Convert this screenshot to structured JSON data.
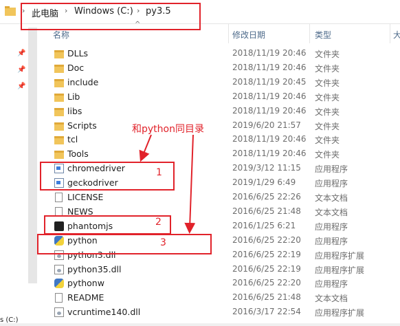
{
  "address": {
    "crumbs": [
      "此电脑",
      "Windows (C:)",
      "py3.5"
    ],
    "separator": "›",
    "up_chevron": "^"
  },
  "nav": {
    "bottom_label": "s (C:)"
  },
  "columns": {
    "name": "名称",
    "date": "修改日期",
    "type": "类型",
    "size": "大"
  },
  "files": [
    {
      "name": "DLLs",
      "date": "2018/11/19 20:46",
      "type": "文件夹",
      "icon": "folder-icon"
    },
    {
      "name": "Doc",
      "date": "2018/11/19 20:46",
      "type": "文件夹",
      "icon": "folder-icon"
    },
    {
      "name": "include",
      "date": "2018/11/19 20:45",
      "type": "文件夹",
      "icon": "folder-icon"
    },
    {
      "name": "Lib",
      "date": "2018/11/19 20:46",
      "type": "文件夹",
      "icon": "folder-icon"
    },
    {
      "name": "libs",
      "date": "2018/11/19 20:46",
      "type": "文件夹",
      "icon": "folder-icon"
    },
    {
      "name": "Scripts",
      "date": "2019/6/20 21:57",
      "type": "文件夹",
      "icon": "folder-icon"
    },
    {
      "name": "tcl",
      "date": "2018/11/19 20:46",
      "type": "文件夹",
      "icon": "folder-icon"
    },
    {
      "name": "Tools",
      "date": "2018/11/19 20:46",
      "type": "文件夹",
      "icon": "folder-icon"
    },
    {
      "name": "chromedriver",
      "date": "2019/3/12 11:15",
      "type": "应用程序",
      "icon": "exe-icon"
    },
    {
      "name": "geckodriver",
      "date": "2019/1/29 6:49",
      "type": "应用程序",
      "icon": "exe-icon"
    },
    {
      "name": "LICENSE",
      "date": "2016/6/25 22:26",
      "type": "文本文档",
      "icon": "text-file-icon"
    },
    {
      "name": "NEWS",
      "date": "2016/6/25 21:48",
      "type": "文本文档",
      "icon": "text-file-icon"
    },
    {
      "name": "phantomjs",
      "date": "2016/1/25 6:21",
      "type": "应用程序",
      "icon": "phantomjs-ghost-icon"
    },
    {
      "name": "python",
      "date": "2016/6/25 22:20",
      "type": "应用程序",
      "icon": "python-icon"
    },
    {
      "name": "python3.dll",
      "date": "2016/6/25 22:19",
      "type": "应用程序扩展",
      "icon": "dll-icon"
    },
    {
      "name": "python35.dll",
      "date": "2016/6/25 22:19",
      "type": "应用程序扩展",
      "icon": "dll-icon"
    },
    {
      "name": "pythonw",
      "date": "2016/6/25 22:20",
      "type": "应用程序",
      "icon": "python-icon"
    },
    {
      "name": "README",
      "date": "2016/6/25 21:48",
      "type": "文本文档",
      "icon": "text-file-icon"
    },
    {
      "name": "vcruntime140.dll",
      "date": "2016/3/17 22:54",
      "type": "应用程序扩展",
      "icon": "dll-icon"
    }
  ],
  "annotations": {
    "note": "和python同目录",
    "label1": "1",
    "label2": "2",
    "label3": "3",
    "color": "#e1222a"
  }
}
